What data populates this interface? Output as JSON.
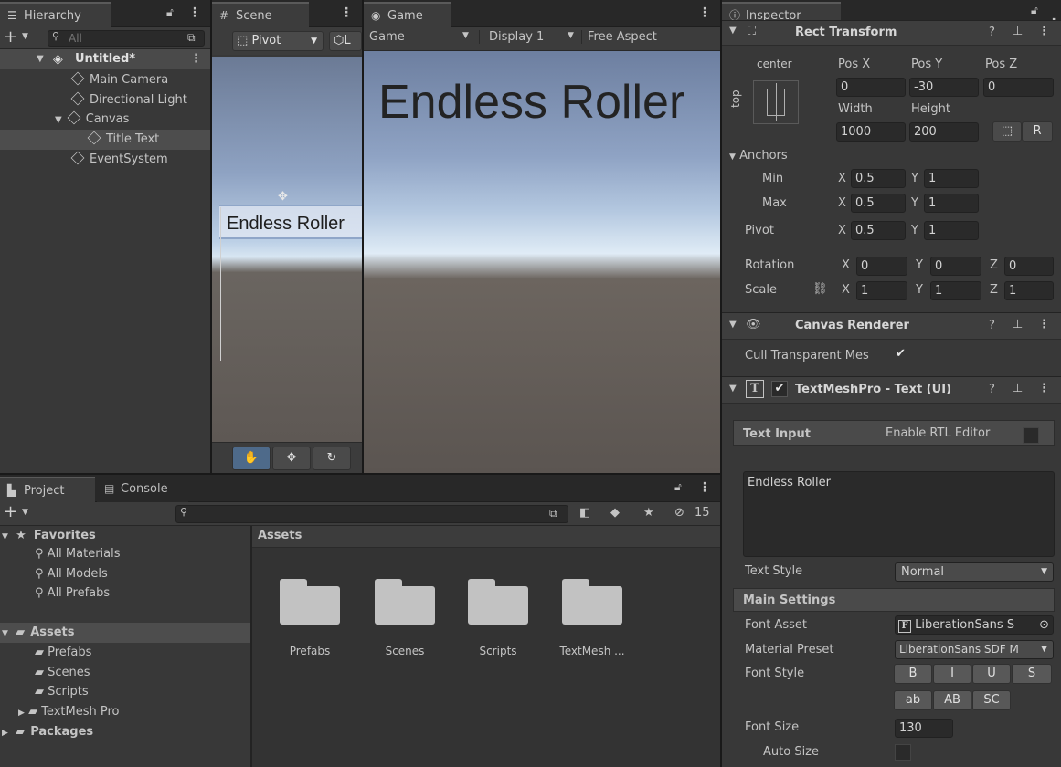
{
  "hierarchy": {
    "tab": "Hierarchy",
    "search_placeholder": "All",
    "scene": "Untitled*",
    "items": [
      "Main Camera",
      "Directional Light",
      "Canvas",
      "Title Text",
      "EventSystem"
    ]
  },
  "scene": {
    "tab": "Scene",
    "pivot": "Pivot",
    "local": "L",
    "preview_text": "Endless Roller"
  },
  "game": {
    "tab": "Game",
    "mode": "Game",
    "display": "Display 1",
    "aspect": "Free Aspect",
    "title_text": "Endless Roller"
  },
  "project": {
    "tabs": [
      "Project",
      "Console"
    ],
    "hidden_count": "15",
    "favorites": {
      "label": "Favorites",
      "items": [
        "All Materials",
        "All Models",
        "All Prefabs"
      ]
    },
    "assets": {
      "label": "Assets",
      "items": [
        "Prefabs",
        "Scenes",
        "Scripts",
        "TextMesh Pro"
      ]
    },
    "packages": "Packages",
    "breadcrumb": "Assets",
    "folders": [
      "Prefabs",
      "Scenes",
      "Scripts",
      "TextMesh ..."
    ]
  },
  "inspector": {
    "tab": "Inspector",
    "rect_transform": {
      "title": "Rect Transform",
      "anchor_h": "center",
      "anchor_v": "top",
      "labels": {
        "posx": "Pos X",
        "posy": "Pos Y",
        "posz": "Pos Z",
        "width": "Width",
        "height": "Height"
      },
      "posx": "0",
      "posy": "-30",
      "posz": "0",
      "width": "1000",
      "height": "200",
      "r_button": "R",
      "anchors_label": "Anchors",
      "min_label": "Min",
      "max_label": "Max",
      "pivot_label": "Pivot",
      "min_x": "0.5",
      "min_y": "1",
      "max_x": "0.5",
      "max_y": "1",
      "pivot_x": "0.5",
      "pivot_y": "1",
      "rotation_label": "Rotation",
      "scale_label": "Scale",
      "rot_x": "0",
      "rot_y": "0",
      "rot_z": "0",
      "scale_x": "1",
      "scale_y": "1",
      "scale_z": "1",
      "axis_x": "X",
      "axis_y": "Y",
      "axis_z": "Z"
    },
    "canvas_renderer": {
      "title": "Canvas Renderer",
      "cull_label": "Cull Transparent Mes"
    },
    "tmp": {
      "title": "TextMeshPro - Text (UI)",
      "text_input_label": "Text Input",
      "rtl_label": "Enable RTL Editor",
      "text_value": "Endless Roller",
      "text_style_label": "Text Style",
      "text_style_value": "Normal",
      "main_settings": "Main Settings",
      "font_asset_label": "Font Asset",
      "font_asset_value": "LiberationSans S",
      "material_preset_label": "Material Preset",
      "material_preset_value": "LiberationSans SDF M",
      "font_style_label": "Font Style",
      "style_buttons": [
        "B",
        "I",
        "U",
        "S",
        "ab",
        "AB",
        "SC"
      ],
      "font_size_label": "Font Size",
      "font_size_value": "130",
      "auto_size_label": "Auto Size"
    }
  }
}
